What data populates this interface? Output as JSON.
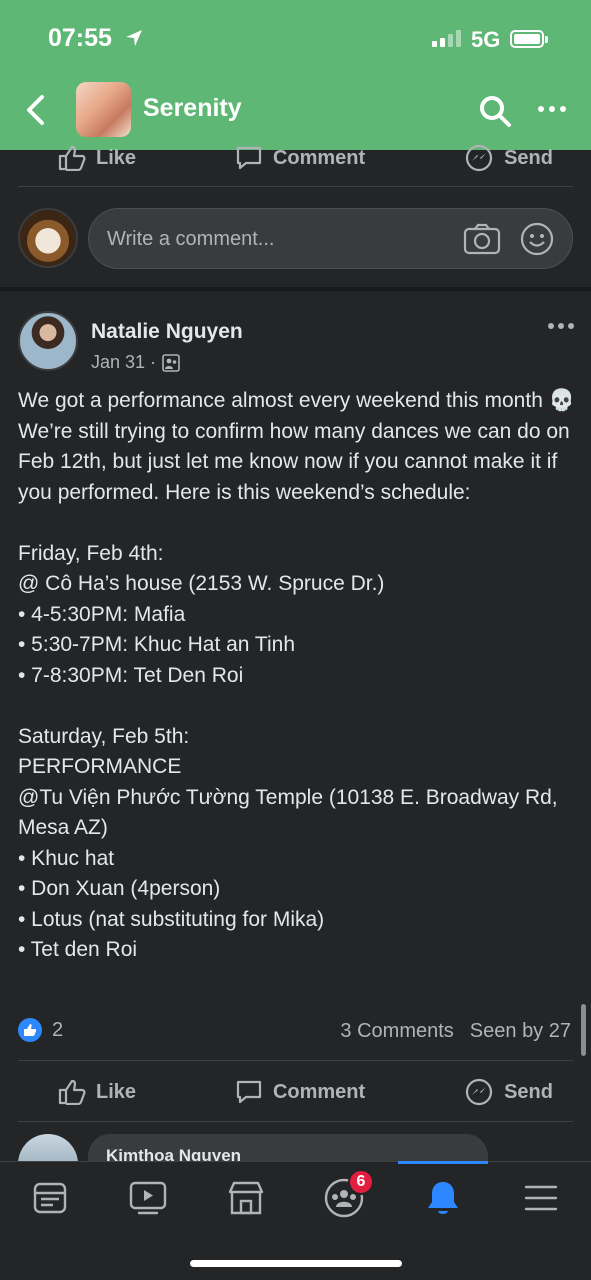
{
  "status_bar": {
    "time": "07:55",
    "network": "5G"
  },
  "header": {
    "title": "Serenity"
  },
  "prev_post_actions": {
    "like": "Like",
    "comment": "Comment",
    "send": "Send"
  },
  "comment_input": {
    "placeholder": "Write a comment..."
  },
  "post": {
    "author": "Natalie Nguyen",
    "date": "Jan 31 ·",
    "body": "We got a performance almost every weekend this month 💀 We’re still trying to confirm how many dances we can do on Feb 12th, but just let me know now if you cannot make it if you performed. Here is this weekend’s schedule:\n\nFriday, Feb 4th:\n@ Cô Ha’s house (2153 W. Spruce Dr.)\n• 4-5:30PM: Mafia\n• 5:30-7PM: Khuc Hat an Tinh\n• 7-8:30PM: Tet Den Roi\n\nSaturday, Feb 5th:\nPERFORMANCE\n@Tu Viện Phước Tường Temple (10138 E. Broadway Rd, Mesa AZ)\n• Khuc hat\n• Don Xuan (4person)\n• Lotus (nat substituting for Mika)\n• Tet den Roi",
    "like_count": "2",
    "comments_count": "3 Comments",
    "seen_by": "Seen by 27",
    "actions": {
      "like": "Like",
      "comment": "Comment",
      "send": "Send"
    },
    "next_commenter": "Kimthoa Nguyen"
  },
  "tabbar": {
    "notifications_badge": "6"
  },
  "colors": {
    "header_green": "#5fb776",
    "accent_blue": "#2d88ff",
    "badge_red": "#e41e3f",
    "surface": "#242526"
  }
}
